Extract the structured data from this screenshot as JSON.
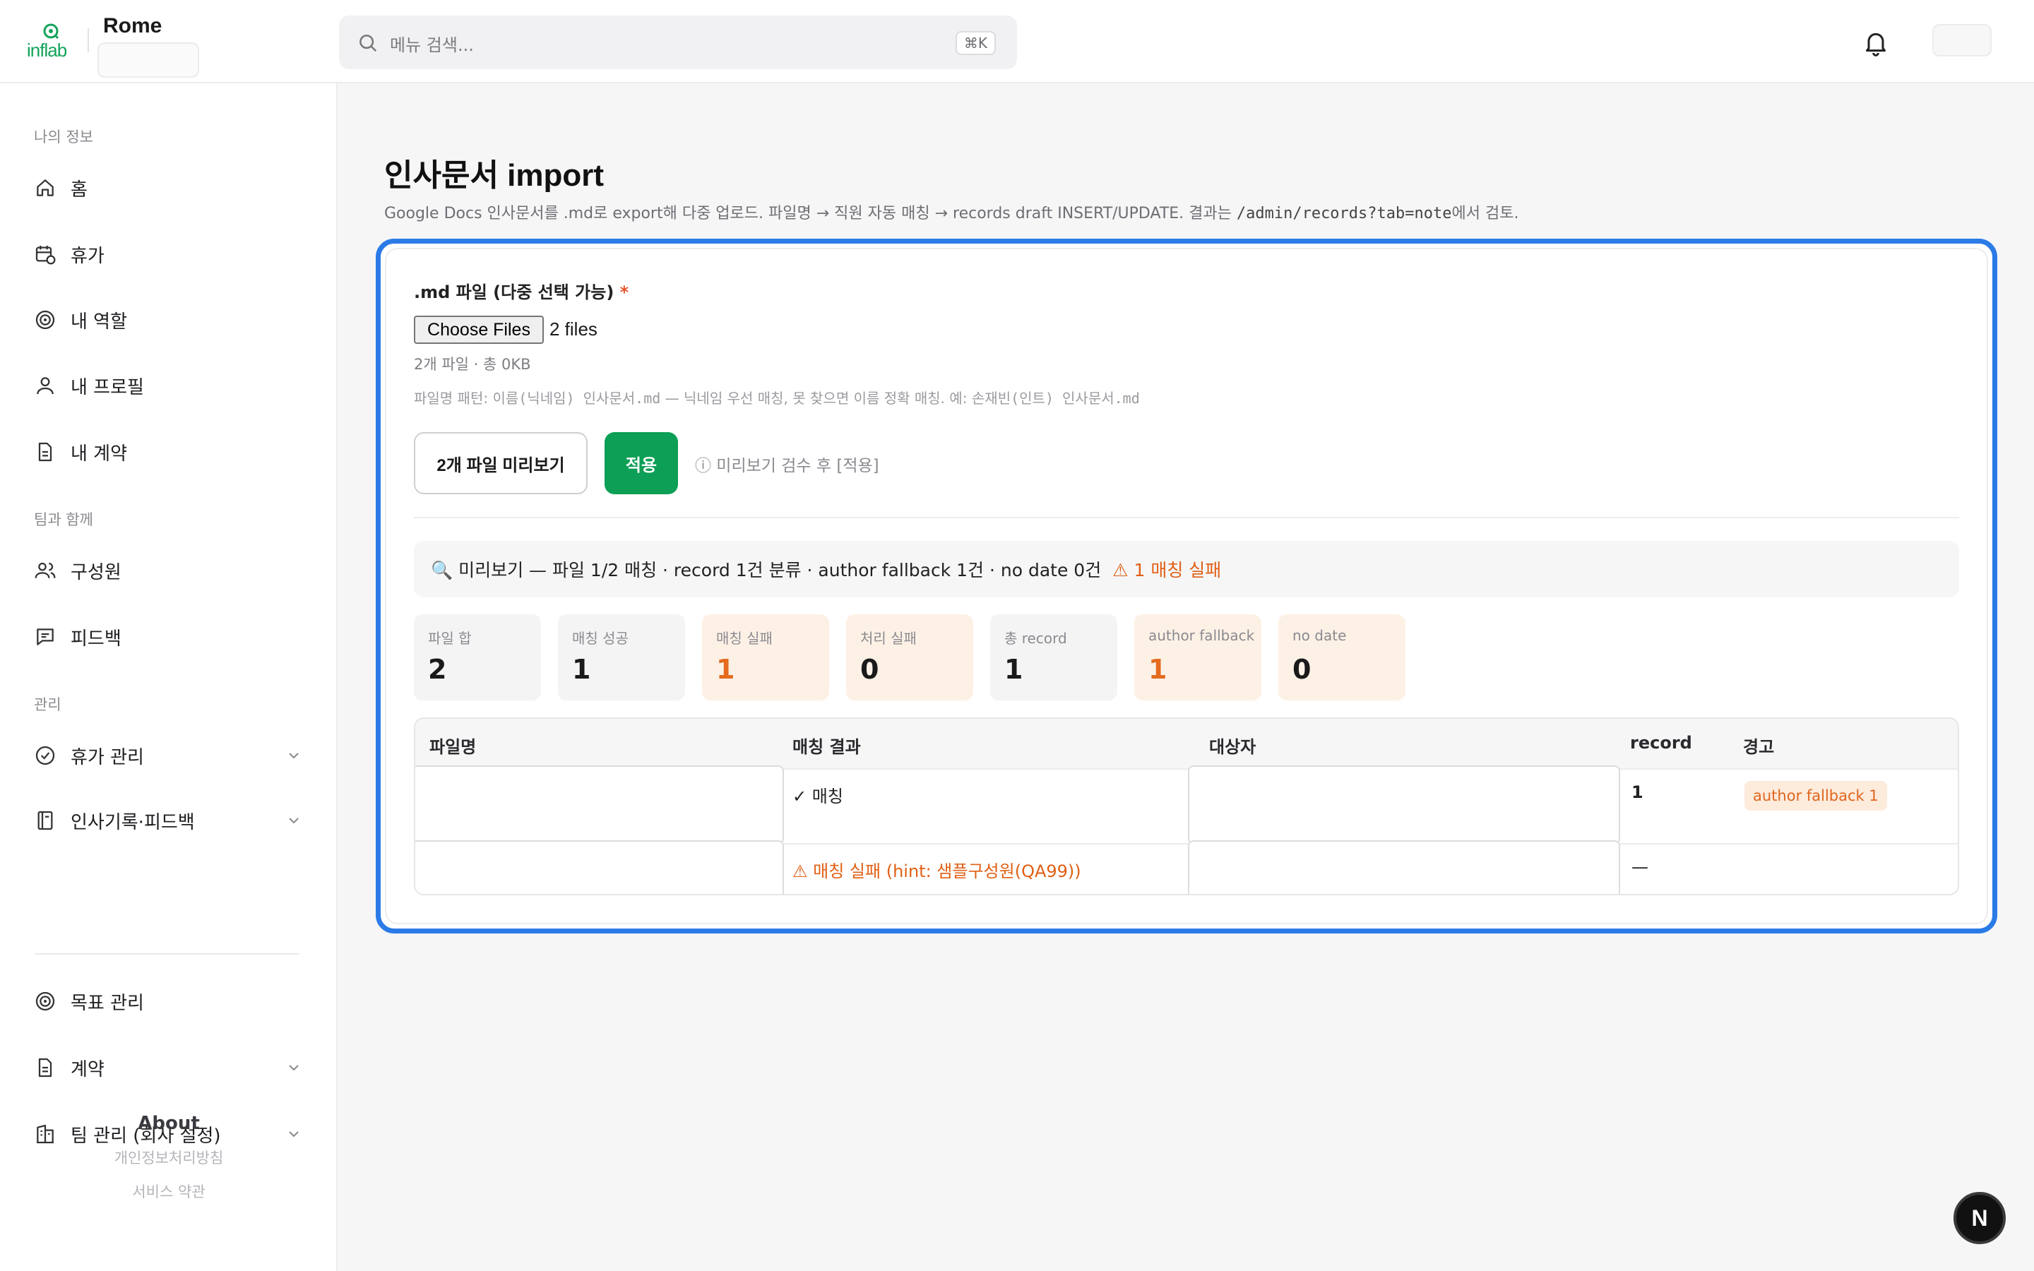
{
  "header": {
    "logo_text": "inflab",
    "brand": "Rome",
    "search_placeholder": "메뉴 검색...",
    "search_shortcut": "⌘K"
  },
  "sidebar": {
    "sections": [
      {
        "label": "나의 정보",
        "items": [
          {
            "label": "홈",
            "icon": "home-icon"
          },
          {
            "label": "휴가",
            "icon": "calendar-clock-icon"
          },
          {
            "label": "내 역할",
            "icon": "target-icon"
          },
          {
            "label": "내 프로필",
            "icon": "user-icon"
          },
          {
            "label": "내 계약",
            "icon": "document-icon"
          }
        ]
      },
      {
        "label": "팀과 함께",
        "items": [
          {
            "label": "구성원",
            "icon": "users-icon"
          },
          {
            "label": "피드백",
            "icon": "message-icon"
          }
        ]
      },
      {
        "label": "관리",
        "items": [
          {
            "label": "휴가 관리",
            "icon": "check-circle-icon"
          },
          {
            "label": "인사기록·피드백",
            "icon": "notebook-icon"
          },
          {
            "label": "목표 관리",
            "icon": "target-icon"
          },
          {
            "label": "계약",
            "icon": "document-icon"
          },
          {
            "label": "팀 관리 (회사 설정)",
            "icon": "building-icon"
          }
        ]
      }
    ],
    "about": {
      "title": "About",
      "links": [
        "개인정보처리방침",
        "서비스 약관"
      ]
    }
  },
  "page": {
    "title": "인사문서 import",
    "desc_pre": "Google Docs 인사문서를 .md로 export해 다중 업로드. 파일명 → 직원 자동 매칭 → records draft INSERT/UPDATE. 결과는 ",
    "desc_code": "/admin/records?tab=note",
    "desc_post": "에서 검토."
  },
  "form": {
    "field_label": ".md 파일 (다중 선택 가능)",
    "required_mark": "*",
    "choose_files": "Choose Files",
    "file_count": "2 files",
    "file_meta": "2개 파일 · 총 0KB",
    "pattern_pre": "파일명 패턴: ",
    "pattern_code1": "이름(닉네임) 인사문서.md",
    "pattern_mid": " — 닉네임 우선 매칭, 못 찾으면 이름 정확 매칭. 예: ",
    "pattern_code2": "손재빈(인트) 인사문서.md",
    "preview_button": "2개 파일 미리보기",
    "apply_button": "적용",
    "apply_hint": "ⓘ 미리보기 검수 후 [적용]"
  },
  "summary": {
    "text": "🔍 미리보기 — 파일 1/2 매칭 · record 1건 분류 · author fallback 1건 · no date 0건",
    "warning": "⚠ 1 매칭 실패"
  },
  "stats": [
    {
      "label": "파일 합",
      "value": "2",
      "tone": "neutral"
    },
    {
      "label": "매칭 성공",
      "value": "1",
      "tone": "neutral"
    },
    {
      "label": "매칭 실패",
      "value": "1",
      "tone": "warning"
    },
    {
      "label": "처리 실패",
      "value": "0",
      "tone": "warning"
    },
    {
      "label": "총 record",
      "value": "1",
      "tone": "neutral"
    },
    {
      "label": "author fallback",
      "value": "1",
      "tone": "warning"
    },
    {
      "label": "no date",
      "value": "0",
      "tone": "warning"
    }
  ],
  "table": {
    "headers": [
      "파일명",
      "매칭 결과",
      "대상자",
      "record",
      "경고"
    ],
    "rows": [
      {
        "filename": "",
        "match": "✓ 매칭",
        "target": "",
        "record": "1",
        "warning": "author fallback 1"
      },
      {
        "filename": "",
        "match": "⚠ 매칭 실패 (hint: 샘플구성원(QA99))",
        "target": "",
        "record": "—",
        "warning": ""
      }
    ]
  },
  "fab": {
    "label": "N"
  },
  "colors": {
    "accent_blue": "#2b7be6",
    "brand_green": "#0c9f55",
    "warning_orange": "#e56b1f"
  }
}
